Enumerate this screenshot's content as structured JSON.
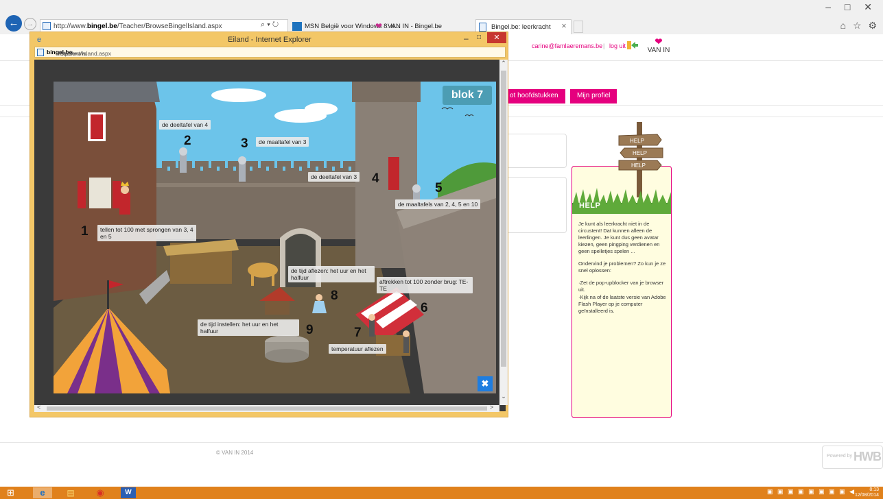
{
  "browser": {
    "url_prefix": "http://www.",
    "url_domain": "bingel.be",
    "url_path": "/Teacher/BrowseBingelIsland.aspx",
    "address_tools": "⌕ ▾ ↻",
    "tabs": [
      {
        "label": "MSN België voor Windows 8: n...",
        "icon": "msn-icon"
      },
      {
        "label": "VAN IN - Bingel.be",
        "icon": "vanin-heart-icon"
      },
      {
        "label": "Bingel.be: leerkracht",
        "icon": "page-icon",
        "active": true
      }
    ],
    "window_controls": "– □ ✕",
    "tool_icons": "⌂ ☆ ⚙"
  },
  "header": {
    "user_email": "carine@famlaeremans.be",
    "separator": "|",
    "logout_label": "log uit",
    "logo_text": "VAN IN"
  },
  "nav": {
    "chapters_label": "ot hoofdstukken",
    "profile_label": "Mijn profiel"
  },
  "help": {
    "title": "HELP",
    "sign_words": [
      "HELP",
      "HELP",
      "HELP"
    ],
    "paragraph1": "Je kunt als leerkracht niet in de circustent! Dat kunnen alleen de leerlingen. Je kunt dus geen avatar kiezen, geen pingping verdienen en geen spelletjes spelen ...",
    "paragraph2": "Ondervind je problemen? Zo kun je ze snel oplossen:",
    "list": [
      "·Zet de pop-upblocker van je browser uit.",
      "·Kijk na of de laatste versie van Adobe Flash Player op je computer geïnstalleerd is."
    ]
  },
  "footer": {
    "copyright": "© VAN IN 2014",
    "powered_by": "Powered by",
    "powered_logo": "HWB"
  },
  "popup": {
    "title": "Eiland - Internet Explorer",
    "url_prefix": "http://www.",
    "url_domain": "bingel.be",
    "url_path": "/Student/Island.aspx",
    "min": "–",
    "max": "□",
    "close": "✕"
  },
  "island": {
    "block_label": "blok 7",
    "activities": [
      {
        "number": "1",
        "label": "tellen tot 100 met sprongen van 3, 4 en 5"
      },
      {
        "number": "2",
        "label": "de deeltafel van 4"
      },
      {
        "number": "3",
        "label": "de maaltafel van 3"
      },
      {
        "number": "4",
        "label": "de deeltafel van 3"
      },
      {
        "number": "5",
        "label": "de maaltafels van 2, 4, 5 en 10"
      },
      {
        "number": "6",
        "label": "aftrekken tot 100 zonder brug: TE-TE"
      },
      {
        "number": "7",
        "label": "temperatuur aflezen"
      },
      {
        "number": "8",
        "label": "de tijd aflezen: het uur en het halfuur"
      },
      {
        "number": "9",
        "label": "de tijd instellen: het uur en het halfuur"
      }
    ],
    "close_label": "✖"
  },
  "taskbar": {
    "word_label": "W",
    "tray_icons": "▣ ▣ ▣ ▣ ▣ ▣ ▣ ▣ ◀",
    "time": "8:13",
    "date": "12/08/2014"
  },
  "colors": {
    "brand_pink": "#e5007e",
    "popup_frame": "#f3c767",
    "taskbar": "#e0811c",
    "ie_blue": "#1e64b4"
  }
}
